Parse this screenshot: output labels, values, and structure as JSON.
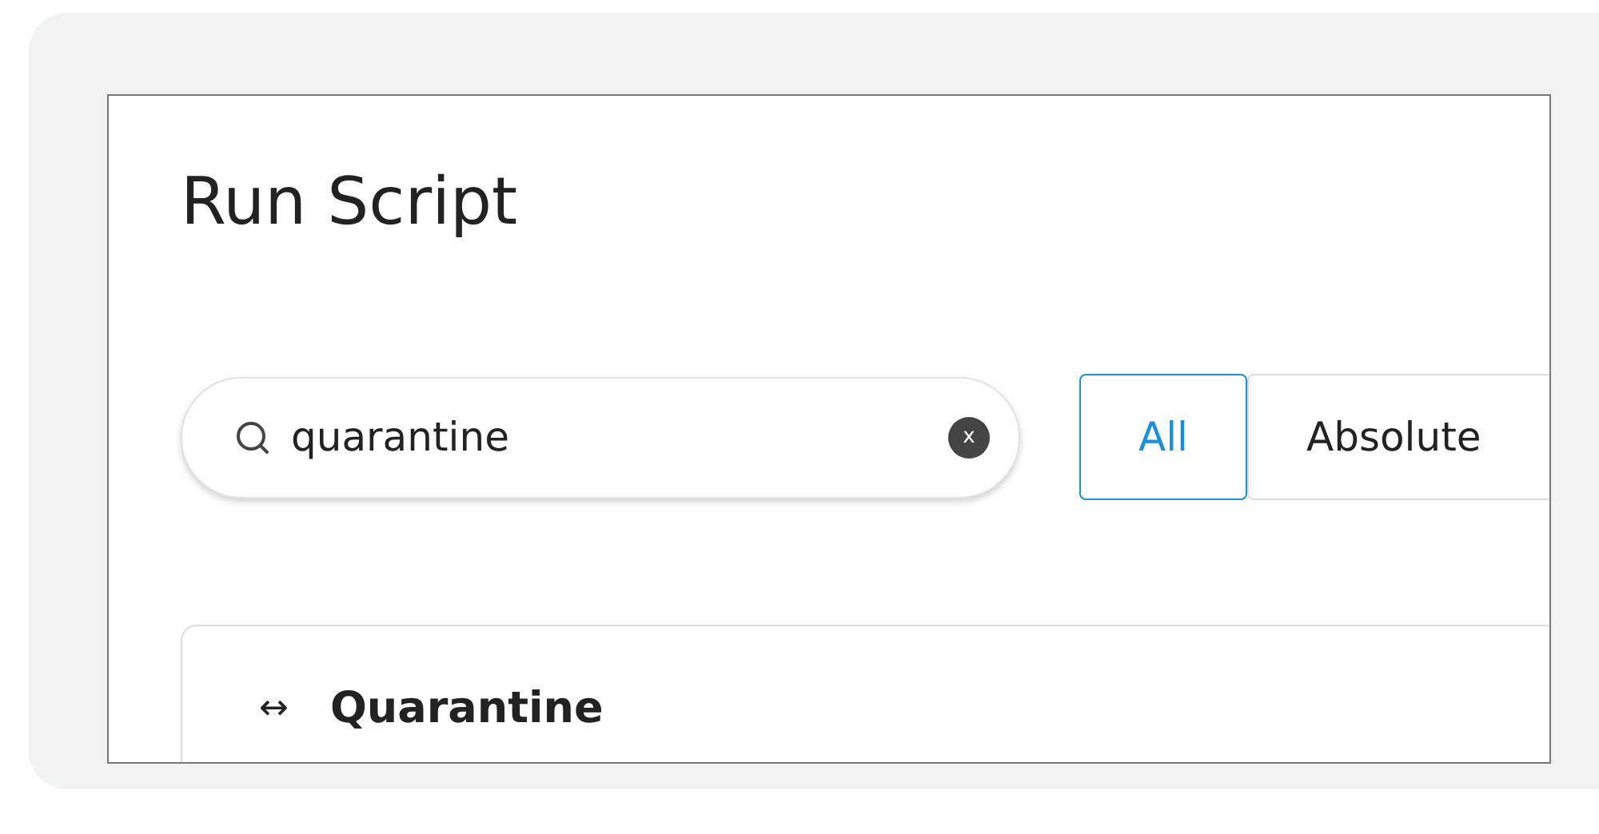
{
  "title": "Run Script",
  "search": {
    "value": "quarantine",
    "clear_label": "x"
  },
  "filters": [
    {
      "label": "All",
      "selected": true
    },
    {
      "label": "Absolute",
      "selected": false
    }
  ],
  "results": [
    {
      "icon": "↔",
      "name": "Quarantine"
    }
  ]
}
